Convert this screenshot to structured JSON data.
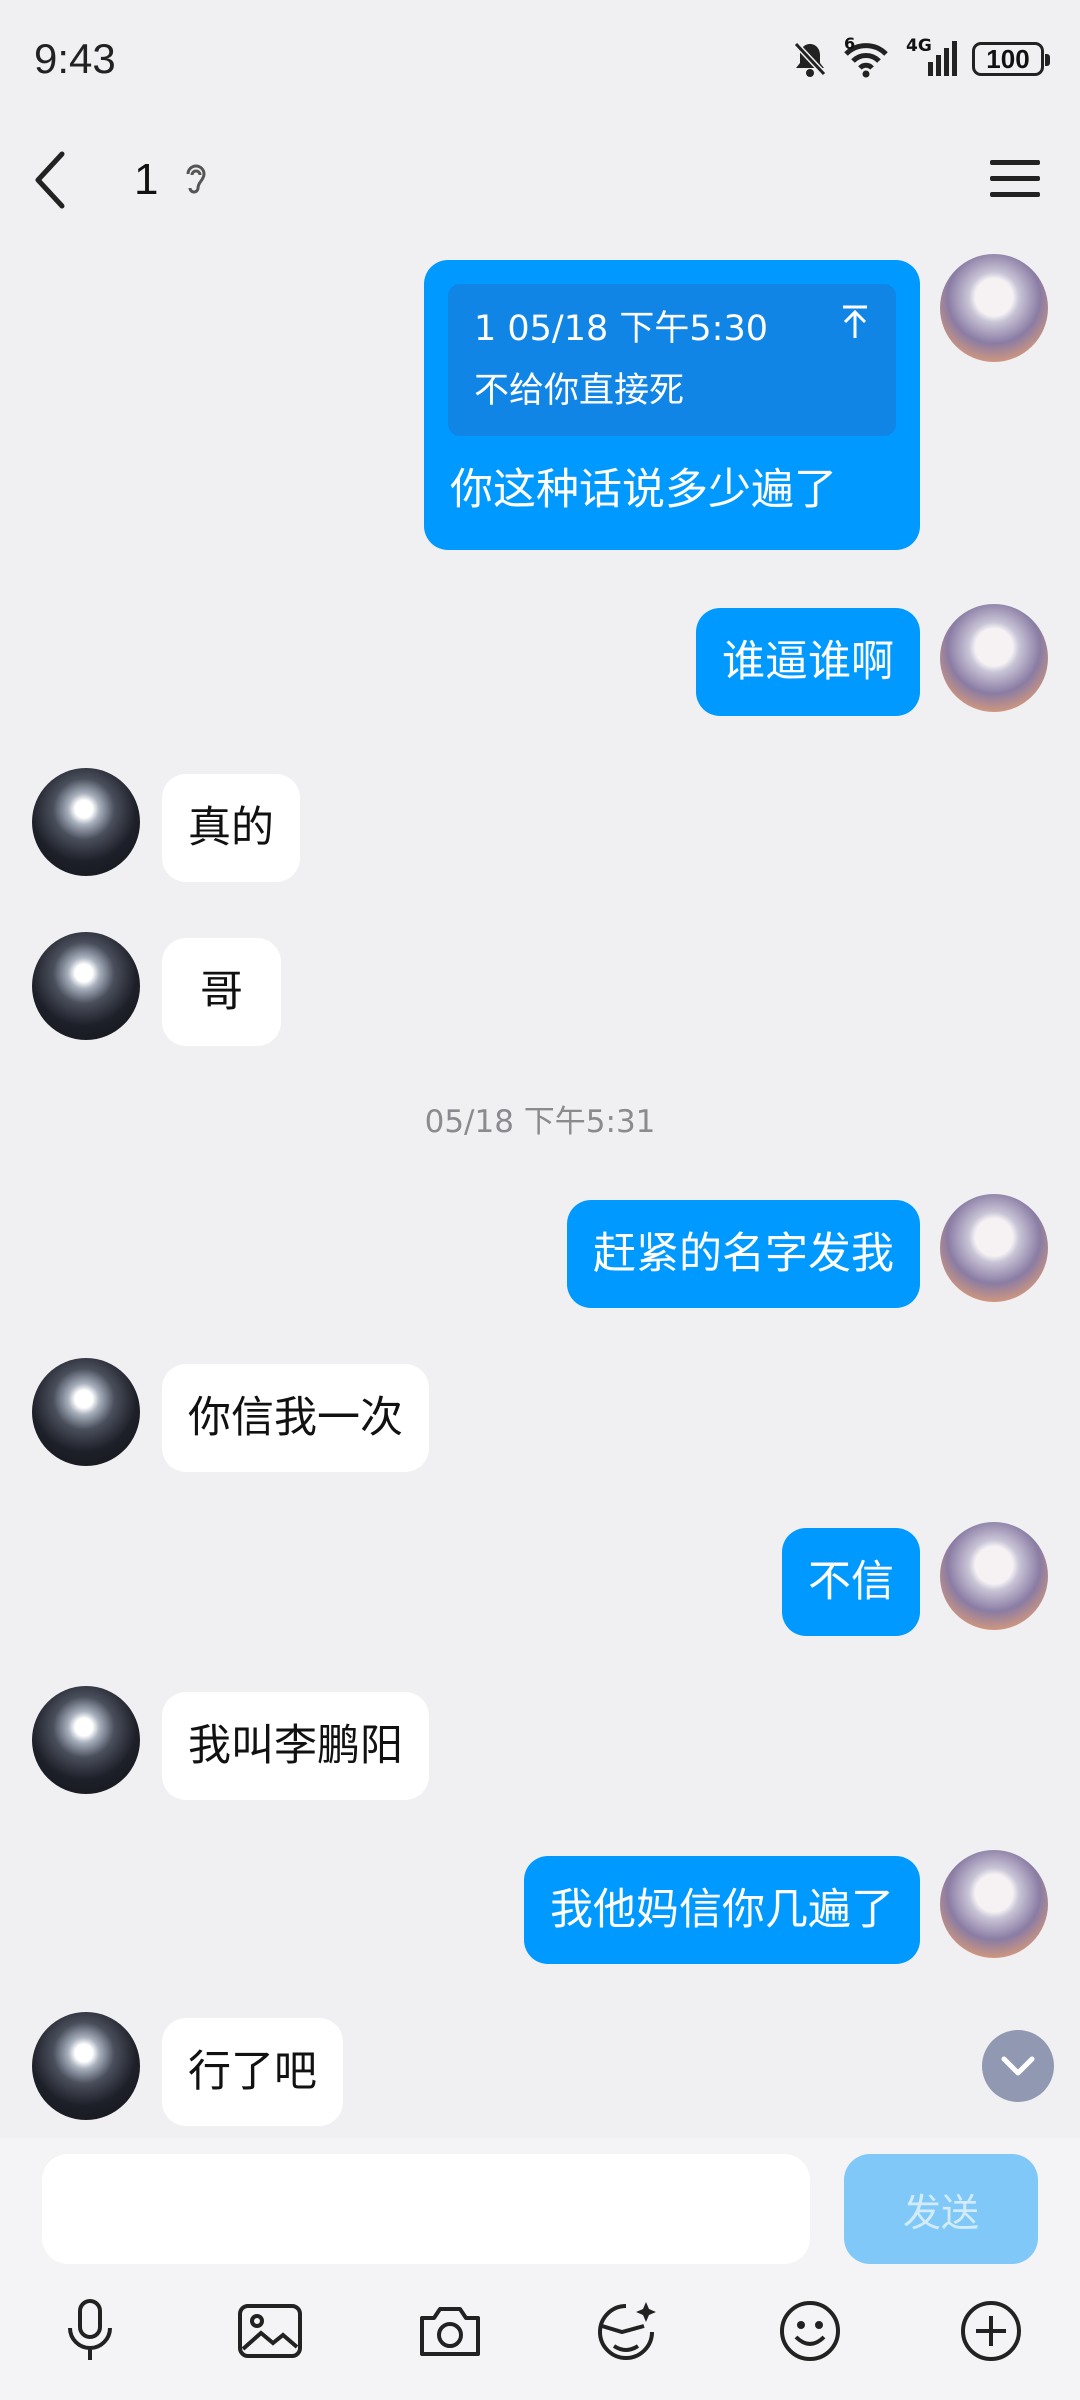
{
  "status_bar": {
    "time": "9:43",
    "battery": "100",
    "signal_label": "4G",
    "wifi_label": "6"
  },
  "header": {
    "title": "1"
  },
  "messages": [
    {
      "quote_text_1": "1 05/18 下午5:30",
      "quote_text_2": "不给你直接死",
      "text": "你这种话说多少遍了"
    },
    {
      "text": "谁逼谁啊"
    },
    {
      "text": "真的"
    },
    {
      "text": "哥"
    },
    {
      "text": "赶紧的名字发我"
    },
    {
      "text": "你信我一次"
    },
    {
      "text": "不信"
    },
    {
      "text": "我叫李鹏阳"
    },
    {
      "text": "我他妈信你几遍了"
    },
    {
      "text": "行了吧"
    }
  ],
  "timestamp": "05/18 下午5:31",
  "input": {
    "value": "",
    "send_label": "发送"
  },
  "toolbar": [
    "mic-icon",
    "image-icon",
    "camera-icon",
    "sticker-icon",
    "emoji-icon",
    "plus-icon"
  ],
  "colors": {
    "my_bubble": "#0099ff",
    "other_bubble": "#ffffff",
    "background": "#f0f0f3"
  }
}
